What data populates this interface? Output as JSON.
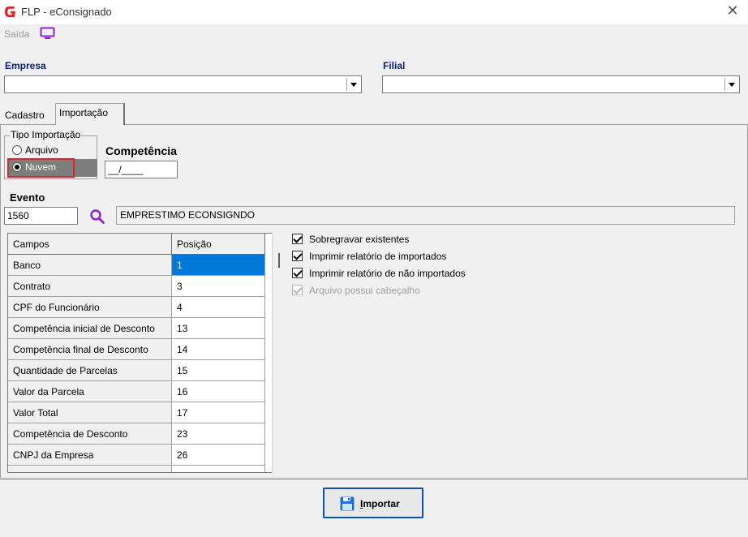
{
  "window": {
    "title": "FLP - eConsignado",
    "close_glyph": "✕",
    "logo_icon": "app-logo-icon"
  },
  "toolbar": {
    "exit_label": "Saída",
    "exit_icon": "monitor-icon"
  },
  "empresa": {
    "label": "Empresa",
    "value": ""
  },
  "filial": {
    "label": "Filial",
    "value": ""
  },
  "tabs": [
    {
      "label": "Cadastro",
      "active": false
    },
    {
      "label": "Importação",
      "active": true
    }
  ],
  "tipo_importacao": {
    "legend": "Tipo Importação",
    "options": [
      {
        "label": "Arquivo",
        "selected": false
      },
      {
        "label": "Nuvem",
        "selected": true
      }
    ]
  },
  "competencia": {
    "label": "Competência",
    "value": "__/____"
  },
  "evento": {
    "label": "Evento",
    "code": "1560",
    "description": "EMPRESTIMO ECONSIGNDO",
    "search_icon": "search-icon"
  },
  "grid": {
    "headers": [
      "Campos",
      "Posição"
    ],
    "rows": [
      {
        "campo": "Banco",
        "posicao": "1",
        "selected": true
      },
      {
        "campo": "Contrato",
        "posicao": "3"
      },
      {
        "campo": "CPF do Funcionário",
        "posicao": "4"
      },
      {
        "campo": "Competência inicial de Desconto",
        "posicao": "13"
      },
      {
        "campo": "Competência final de Desconto",
        "posicao": "14"
      },
      {
        "campo": "Quantidade de Parcelas",
        "posicao": "15"
      },
      {
        "campo": "Valor da Parcela",
        "posicao": "16"
      },
      {
        "campo": "Valor Total",
        "posicao": "17"
      },
      {
        "campo": "Competência de Desconto",
        "posicao": "23"
      },
      {
        "campo": "CNPJ da Empresa",
        "posicao": "26"
      },
      {
        "campo": "",
        "posicao": ""
      }
    ]
  },
  "options": [
    {
      "label": "Sobregravar existentes",
      "checked": true,
      "enabled": true
    },
    {
      "label": "Imprimir relatório de importados",
      "checked": true,
      "enabled": true
    },
    {
      "label": "Imprimir relatório de não importados",
      "checked": true,
      "enabled": true
    },
    {
      "label": "Arquivo possui cabeçalho",
      "checked": true,
      "enabled": false
    }
  ],
  "import_button": {
    "accel": "I",
    "rest": "mportar",
    "icon": "save-icon"
  },
  "colors": {
    "accent": "#0078d7",
    "logo": "#d8262a",
    "header_label": "#0b1e7a",
    "highlight": "#d8262a",
    "icon_purple": "#8a1fd6"
  }
}
